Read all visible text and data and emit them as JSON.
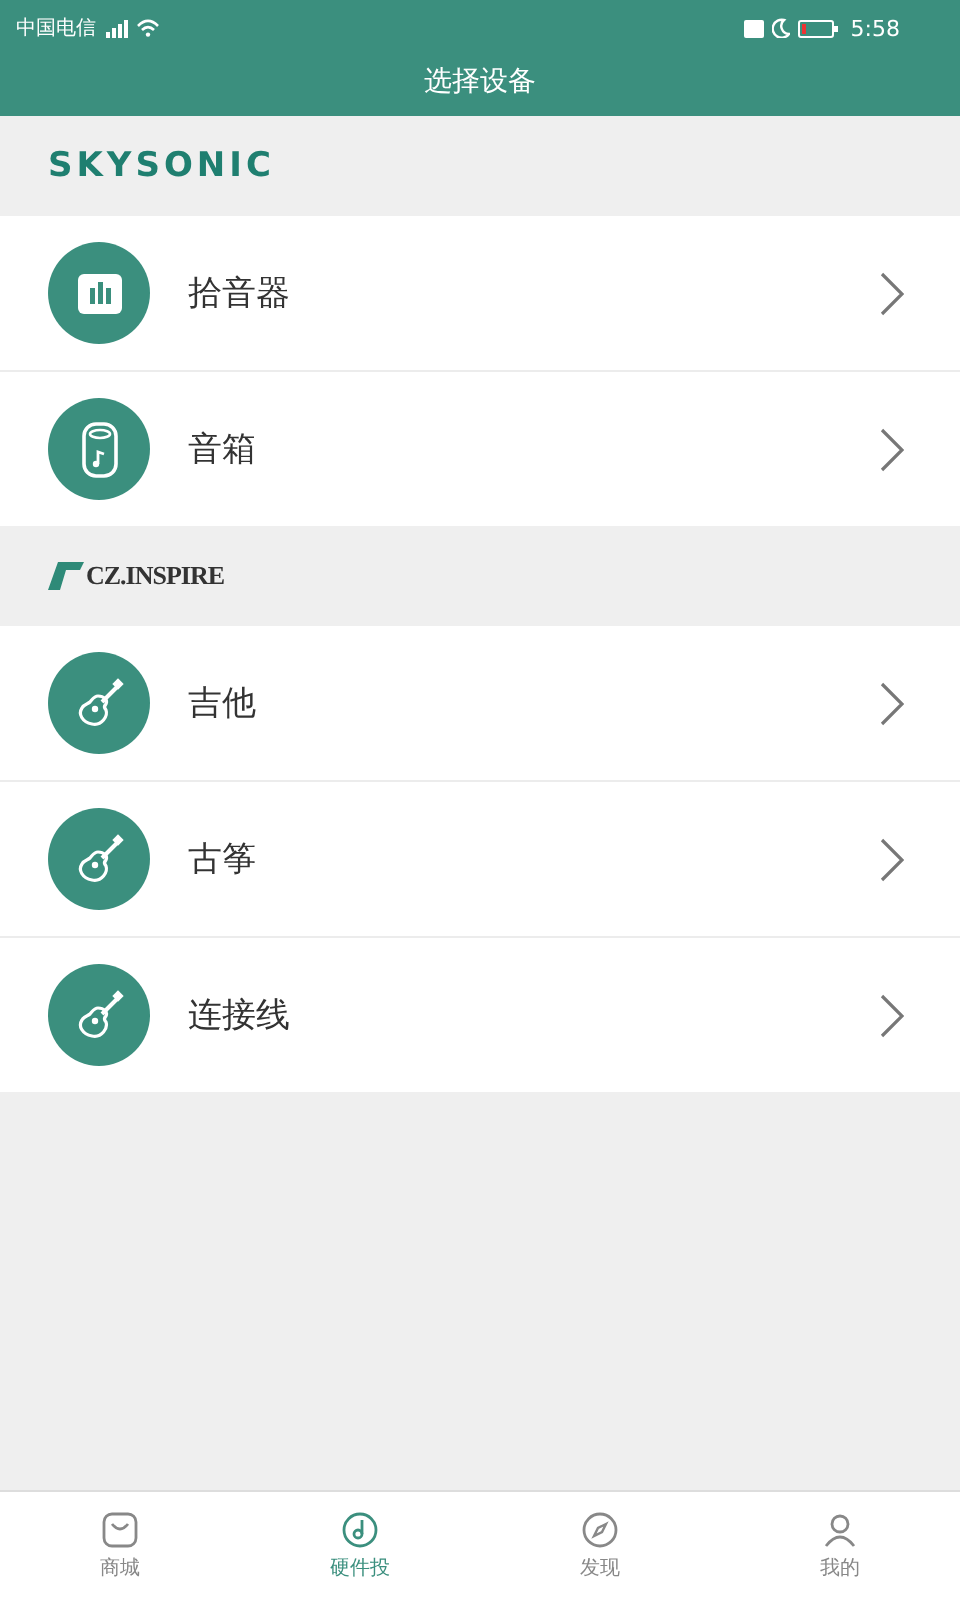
{
  "status_bar": {
    "carrier": "中国电信",
    "time": "5:58"
  },
  "header": {
    "title": "选择设备"
  },
  "sections": [
    {
      "brand": "SKYSONIC",
      "kind": "skysonic",
      "items": [
        {
          "label": "拾音器",
          "kind": "bars"
        },
        {
          "label": "音箱",
          "kind": "speaker"
        }
      ]
    },
    {
      "brand": "CZ.INSPIRE",
      "kind": "czinspire",
      "items": [
        {
          "label": "吉他",
          "kind": "guitar"
        },
        {
          "label": "古筝",
          "kind": "guitar"
        },
        {
          "label": "连接线",
          "kind": "guitar"
        }
      ]
    }
  ],
  "tab_bar": [
    {
      "label": "商城",
      "kind": "bag",
      "selected": false
    },
    {
      "label": "硬件投",
      "kind": "note",
      "selected": true
    },
    {
      "label": "发现",
      "kind": "compass",
      "selected": false
    },
    {
      "label": "我的",
      "kind": "person",
      "selected": false
    }
  ]
}
